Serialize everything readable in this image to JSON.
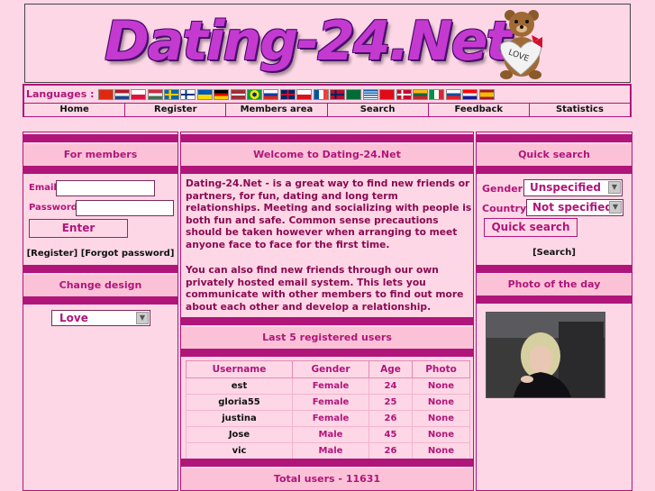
{
  "site": {
    "logo_text": "Dating-24.Net",
    "bear_badge": "LOVE"
  },
  "languages": {
    "label": "Languages :",
    "flags": [
      "china-flag",
      "netherlands-flag",
      "poland-flag",
      "hungary-flag",
      "sweden-flag",
      "finland-flag",
      "ukraine-flag",
      "germany-flag",
      "latvia-flag",
      "brazil-flag",
      "russia-flag",
      "uk-flag",
      "czech-flag",
      "france-flag",
      "norway-flag",
      "saudi-flag",
      "greece-flag",
      "turkey-flag",
      "denmark-flag",
      "lithuania-flag",
      "italy-flag",
      "slovakia-flag",
      "croatia-flag",
      "spain-flag"
    ]
  },
  "menu": [
    "Home",
    "Register",
    "Members area",
    "Search",
    "Feedback",
    "Statistics"
  ],
  "left": {
    "members_title": "For members",
    "email_label": "Email",
    "password_label": "Password",
    "enter_label": "Enter",
    "links": "[Register] [Forgot password]",
    "design_title": "Change design",
    "design_value": "Love"
  },
  "center": {
    "welcome_title": "Welcome to Dating-24.Net",
    "welcome_p1": "Dating-24.Net - is a great way to find new friends or partners, for fun, dating and long term relationships. Meeting and socializing with people is both fun and safe. Common sense precautions should be taken however when arranging to meet anyone face to face for the first time.",
    "welcome_p2": "You can also find new friends through our own privately hosted email system. This lets you communicate with other members to find out more about each other and develop a relationship.",
    "last_title": "Last 5 registered users",
    "table": {
      "headers": [
        "Username",
        "Gender",
        "Age",
        "Photo"
      ],
      "rows": [
        [
          "est",
          "Female",
          "24",
          "None"
        ],
        [
          "gloria55",
          "Female",
          "25",
          "None"
        ],
        [
          "justina",
          "Female",
          "26",
          "None"
        ],
        [
          "Jose",
          "Male",
          "45",
          "None"
        ],
        [
          "vic",
          "Male",
          "26",
          "None"
        ]
      ]
    },
    "total": "Total users - 11631"
  },
  "right": {
    "quick_title": "Quick search",
    "gender_label": "Gender",
    "gender_value": "Unspecified",
    "country_label": "Country",
    "country_value": "Not specified",
    "search_btn": "Quick search",
    "search_link": "[Search]",
    "photo_title": "Photo of the day"
  },
  "colors": {
    "bg": "#fdd7e6",
    "accent": "#b0157a",
    "title_bg": "#fbc2d7"
  }
}
